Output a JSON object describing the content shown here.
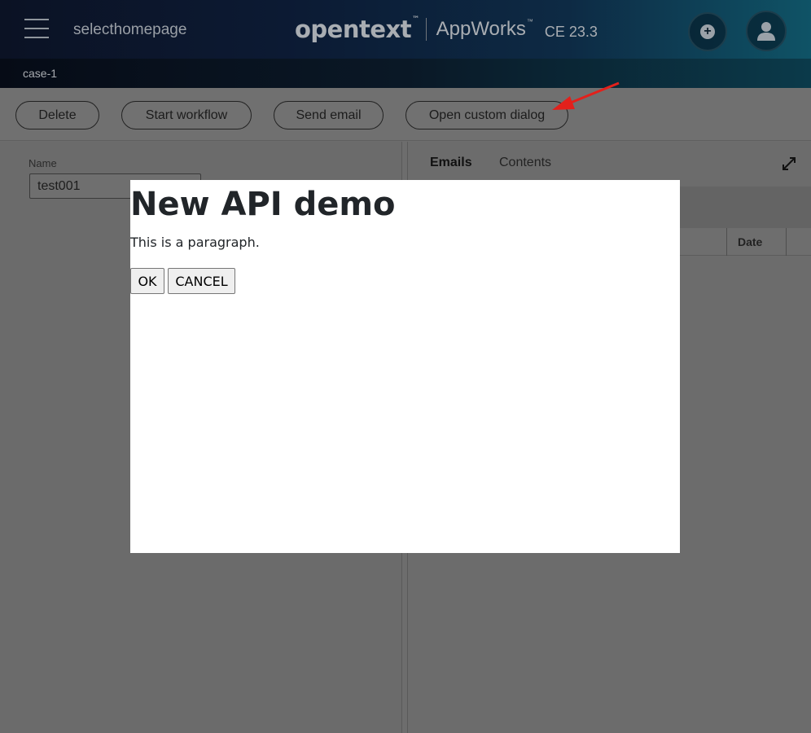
{
  "header": {
    "app_title": "selecthomepage",
    "brand_logo": "opentext",
    "brand_logo_tm": "™",
    "brand_product": "AppWorks",
    "brand_product_tm": "™",
    "brand_version": "CE 23.3",
    "add_icon": "plus-circle-icon",
    "user_icon": "user-icon",
    "breadcrumb": "case-1"
  },
  "toolbar": {
    "buttons": [
      {
        "label": "Delete"
      },
      {
        "label": "Start workflow"
      },
      {
        "label": "Send email"
      },
      {
        "label": "Open custom dialog"
      }
    ]
  },
  "form": {
    "name_label": "Name",
    "name_value": "test001"
  },
  "right_panel": {
    "tabs": [
      {
        "label": "Emails",
        "active": true
      },
      {
        "label": "Contents",
        "active": false
      }
    ],
    "expand_icon": "expand-icon",
    "columns": [
      {
        "label": "Date"
      }
    ]
  },
  "dialog": {
    "title": "New API demo",
    "paragraph": "This is a paragraph.",
    "ok_label": "OK",
    "cancel_label": "CANCEL"
  },
  "annotation": {
    "arrow_color": "#e3201b"
  }
}
